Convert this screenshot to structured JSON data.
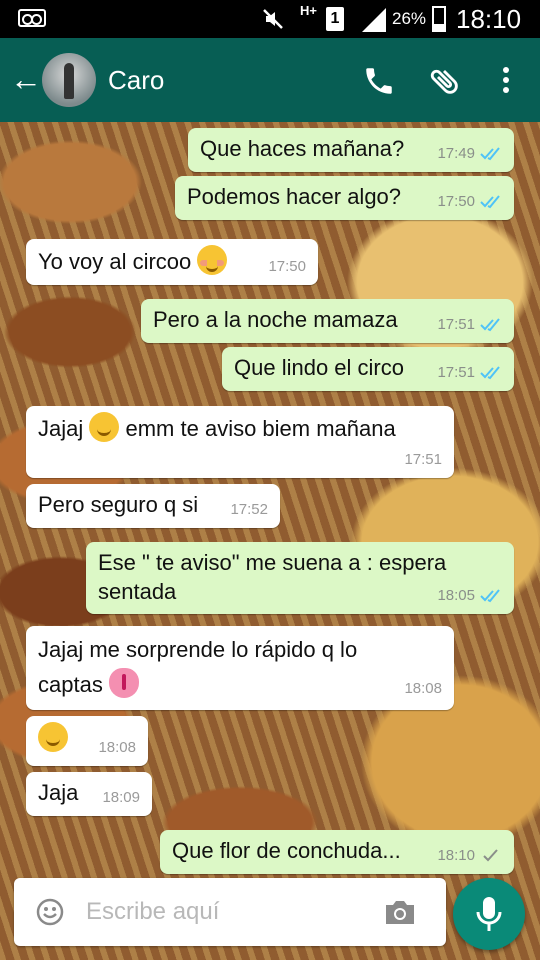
{
  "status_bar": {
    "network": "H+",
    "sim": "1",
    "battery": "26%",
    "time": "18:10"
  },
  "header": {
    "contact_name": "Caro",
    "icons": [
      "back-arrow-icon",
      "avatar",
      "phone-icon",
      "paperclip-icon",
      "more-vert-icon"
    ]
  },
  "messages": [
    {
      "dir": "out",
      "text": "Que haces mañana?",
      "time": "17:49",
      "status": "read"
    },
    {
      "dir": "out",
      "text": "Podemos hacer algo?",
      "time": "17:50",
      "status": "read"
    },
    {
      "dir": "in",
      "text": "Yo voy al circoo",
      "emoji": "blush",
      "time": "17:50"
    },
    {
      "dir": "out",
      "text": "Pero a la noche mamaza",
      "time": "17:51",
      "status": "read"
    },
    {
      "dir": "out",
      "text": "Que lindo el circo",
      "time": "17:51",
      "status": "read"
    },
    {
      "dir": "in",
      "text_before": "Jajaj",
      "emoji": "smile",
      "text_after": "emm te aviso biem mañana",
      "time": "17:51"
    },
    {
      "dir": "in",
      "text": "Pero seguro q si",
      "time": "17:52"
    },
    {
      "dir": "out",
      "line1": "Ese \" te aviso\" me suena a : espera",
      "line2": "sentada",
      "time": "18:05",
      "status": "read"
    },
    {
      "dir": "in",
      "line1": "Jajaj me sorprende lo rápido q lo",
      "line2": "captas",
      "emoji": "tongue",
      "time": "18:08"
    },
    {
      "dir": "in",
      "emoji": "smile",
      "time": "18:08"
    },
    {
      "dir": "in",
      "text": "Jaja",
      "time": "18:09"
    },
    {
      "dir": "out",
      "text": "Que flor de conchuda...",
      "time": "18:10",
      "status": "delivered"
    }
  ],
  "input": {
    "placeholder": "Escribe aquí"
  },
  "colors": {
    "header": "#075e54",
    "outgoing_bubble": "#dcf8c6",
    "incoming_bubble": "#ffffff",
    "read_ticks": "#4fc3f7",
    "mic_button": "#0a8a78"
  }
}
